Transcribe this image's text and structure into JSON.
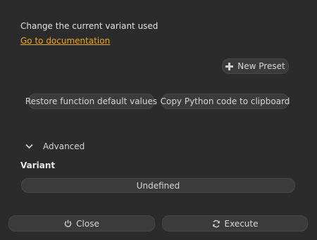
{
  "description": "Change the current variant used",
  "doc_link": "Go to documentation",
  "new_preset_label": "New Preset",
  "restore_label": "Restore function default values",
  "copy_label": "Copy Python code to clipboard",
  "advanced_label": "Advanced",
  "variant": {
    "label": "Variant",
    "value": "Undefined"
  },
  "footer": {
    "close_label": "Close",
    "execute_label": "Execute"
  },
  "colors": {
    "background": "#2b2b2b",
    "button": "#3b3b3b",
    "link": "#f0a81a"
  }
}
